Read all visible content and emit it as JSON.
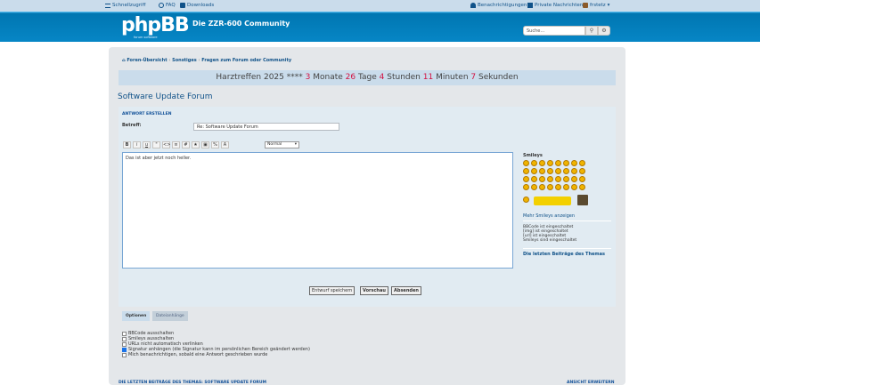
{
  "topnav": {
    "quicklinks": "Schnellzugriff",
    "faq": "FAQ",
    "downloads": "Downloads",
    "notifications": "Benachrichtigungen",
    "messages": "Private Nachrichten",
    "user": "frstetz"
  },
  "header": {
    "logo": "phpBB",
    "logo_sub": "forum  software",
    "site_name": "Die ZZR-600 Community",
    "search_placeholder": "Suche…"
  },
  "breadcrumb": {
    "home": "Foren-Übersicht",
    "sep1": "‹",
    "cat": "Sonstiges",
    "sep2": "‹",
    "forum": "Fragen zum Forum oder Community"
  },
  "countdown": {
    "prefix": "Harztreffen 2025 ****",
    "months": "3",
    "months_label": "Monate",
    "days": "26",
    "days_label": "Tage",
    "hours": "4",
    "hours_label": "Stunden",
    "minutes": "11",
    "minutes_label": "Minuten",
    "seconds": "7",
    "seconds_label": "Sekunden"
  },
  "forum_title": "Software Update Forum",
  "post": {
    "section": "Antwort erstellen",
    "subject_label": "Betreff:",
    "subject_value": "Re: Software Update Forum",
    "font_size": "Normal",
    "message": "Das ist aber jetzt noch heller."
  },
  "toolbar": [
    "B",
    "i",
    "u",
    "\"",
    "<>",
    "≡",
    "#",
    "★",
    "▣",
    "%",
    "A"
  ],
  "sidebar": {
    "smileys_title": "Smileys",
    "more_smileys": "Mehr Smileys anzeigen",
    "bbcode": "BBCode ist eingeschaltet",
    "img": "[img] ist eingeschaltet",
    "url": "[url] ist eingeschaltet",
    "smilies": "Smileys sind eingeschaltet",
    "last_posts": "Die letzten Beiträge des Themas"
  },
  "buttons": {
    "draft": "Entwurf speichern",
    "preview": "Vorschau",
    "submit": "Absenden"
  },
  "tabs": {
    "options": "Optionen",
    "attachments": "Dateianhänge"
  },
  "options": [
    {
      "label": "BBCode ausschalten",
      "checked": false
    },
    {
      "label": "Smileys ausschalten",
      "checked": false
    },
    {
      "label": "URLs nicht automatisch verlinken",
      "checked": false
    },
    {
      "label": "Signatur anhängen (die Signatur kann im persönlichen Bereich geändert werden)",
      "checked": true
    },
    {
      "label": "Mich benachrichtigen, sobald eine Antwort geschrieben wurde",
      "checked": false
    }
  ],
  "footer": {
    "left": "Die letzten Beiträge des Themas: Software Update Forum",
    "right": "Ansicht erweitern"
  },
  "colors": {
    "link": "#105289",
    "header_blue": "#12a3eb",
    "countdown_red": "#d31141"
  }
}
